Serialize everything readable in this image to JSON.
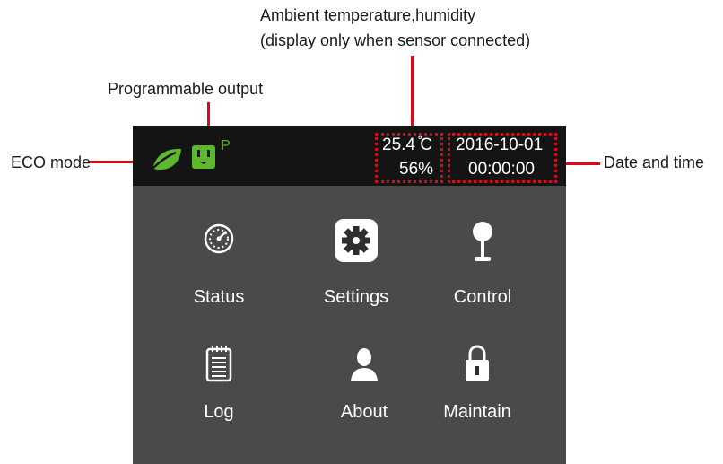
{
  "annotations": {
    "ambient_line1": "Ambient temperature,humidity",
    "ambient_line2": "(display only when sensor connected)",
    "programmable_output": "Programmable output",
    "eco_mode": "ECO mode",
    "date_and_time": "Date and time"
  },
  "status_bar": {
    "programmable_indicator": "P",
    "temperature": "25.4 ̊C",
    "humidity": "56%",
    "date": "2016-10-01",
    "time": "00:00:00"
  },
  "menu": [
    {
      "label": "Status",
      "icon": "gauge-icon"
    },
    {
      "label": "Settings",
      "icon": "gear-icon"
    },
    {
      "label": "Control",
      "icon": "joystick-icon"
    },
    {
      "label": "Log",
      "icon": "notepad-icon"
    },
    {
      "label": "About",
      "icon": "person-icon"
    },
    {
      "label": "Maintain",
      "icon": "padlock-icon"
    }
  ],
  "colors": {
    "screen_bg": "#4a4a4a",
    "topbar_bg": "#141414",
    "eco_green": "#5cb82c",
    "annotation_red": "#e30613"
  }
}
